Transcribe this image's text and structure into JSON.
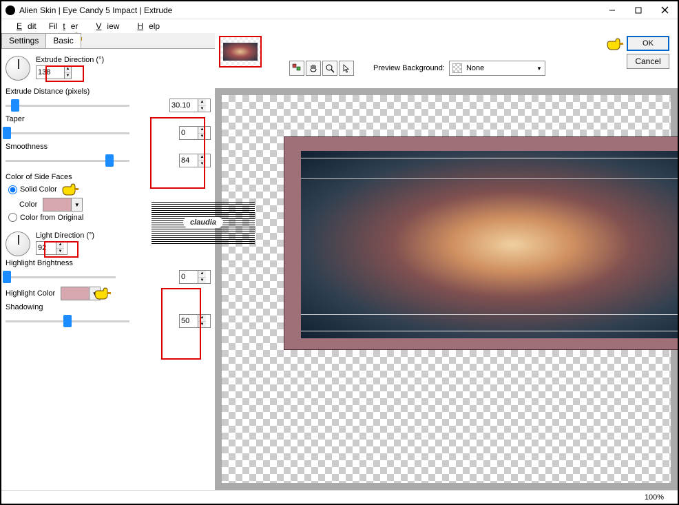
{
  "window": {
    "title": "Alien Skin | Eye Candy 5 Impact | Extrude"
  },
  "menu": {
    "edit": "Edit",
    "filter": "Filter",
    "view": "View",
    "help": "Help"
  },
  "tabs": {
    "settings": "Settings",
    "basic": "Basic"
  },
  "fields": {
    "extrude_direction_label": "Extrude Direction (°)",
    "extrude_direction_value": "138",
    "extrude_distance_label": "Extrude Distance (pixels)",
    "extrude_distance_value": "30.10",
    "taper_label": "Taper",
    "taper_value": "0",
    "smoothness_label": "Smoothness",
    "smoothness_value": "84",
    "side_faces_header": "Color of Side Faces",
    "solid_color_label": "Solid Color",
    "color_label": "Color",
    "color_from_original_label": "Color from Original",
    "light_direction_label": "Light Direction (°)",
    "light_direction_value": "92",
    "highlight_brightness_label": "Highlight Brightness",
    "highlight_brightness_value": "0",
    "highlight_color_label": "Highlight Color",
    "shadowing_label": "Shadowing",
    "shadowing_value": "50"
  },
  "colors": {
    "side_face": "#d8a8b0",
    "highlight": "#d8a8b0"
  },
  "preview": {
    "bg_label": "Preview Background:",
    "bg_value": "None"
  },
  "buttons": {
    "ok": "OK",
    "cancel": "Cancel"
  },
  "status": {
    "zoom": "100%"
  },
  "watermark": "claudia"
}
